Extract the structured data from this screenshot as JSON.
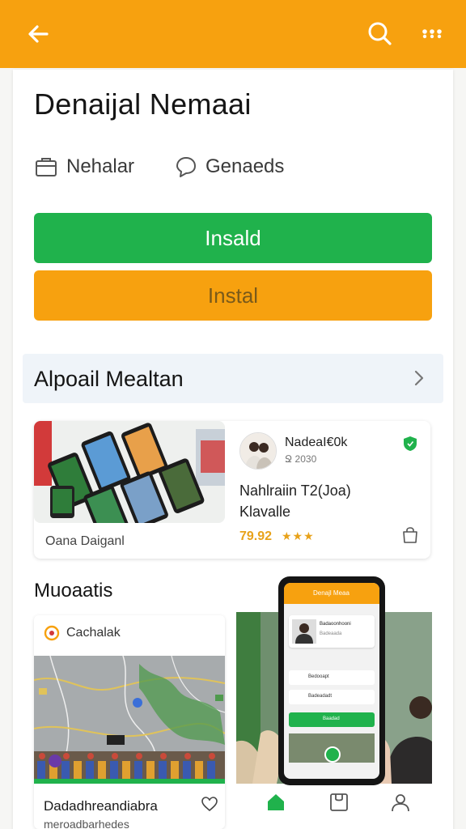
{
  "header": {
    "back_icon": "arrow-left-icon",
    "search_icon": "search-icon",
    "more_icon": "more-dots-icon",
    "color": "#f7a10f"
  },
  "app": {
    "title": "Denaijal Nemaai",
    "developer": "Nehalar",
    "category": "Genaeds"
  },
  "buttons": {
    "primary_label": "Insald",
    "secondary_label": "Instal",
    "primary_color": "#20b24c",
    "secondary_color": "#f7a10f"
  },
  "section": {
    "title": "Alpoail Mealtan"
  },
  "feature": {
    "caption": "Oana Daiganl",
    "dev_name": "NadeaI€0k",
    "dev_sub": "Ջ 2030",
    "desc_line1": "Nahlraiin T2(Joa)",
    "desc_line2": "Klavalle",
    "rating": "79.92",
    "stars": "★★★"
  },
  "subsection": {
    "title": "Muoaatis"
  },
  "tile_left": {
    "location": "Cachalak",
    "name": "Dadadhreandiabra",
    "sub": "meroadbarhedes"
  },
  "phone_mock": {
    "header_title": "Denajl Meaa",
    "row_title": "Badaoonhooni",
    "row_sub": "Badeaada",
    "item1": "Bedooapt",
    "item2": "Badeadadt",
    "button": "Baadad"
  }
}
